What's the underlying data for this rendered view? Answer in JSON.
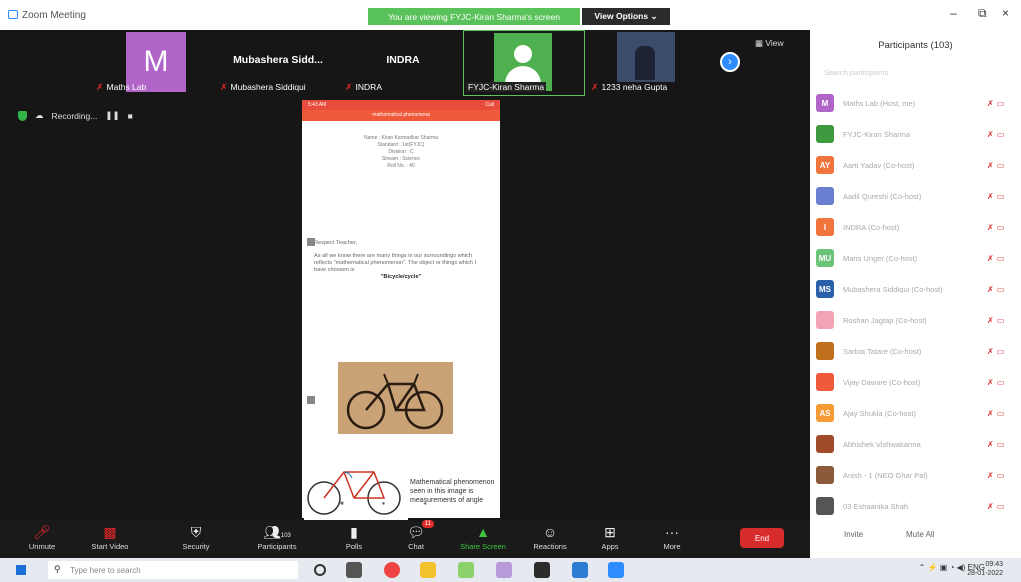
{
  "window": {
    "title": "Zoom Meeting",
    "banner": "You are viewing FYJC-Kiran Sharma's screen",
    "view_options": "View Options ⌄"
  },
  "thumbnails": [
    {
      "name": "Maths Lab",
      "avatar_letter": "M",
      "avatar_color": "#b165c9",
      "big_name": ""
    },
    {
      "name": "Mubashera Siddiqui",
      "avatar_letter": "",
      "avatar_color": "",
      "big_name": "Mubashera Sidd..."
    },
    {
      "name": "INDRA",
      "avatar_letter": "",
      "avatar_color": "",
      "big_name": "INDRA"
    },
    {
      "name": "FYJC-Kiran Sharma",
      "avatar_letter": "",
      "avatar_color": "#4fb04f",
      "big_name": ""
    },
    {
      "name": "1233 neha Gupta",
      "avatar_letter": "",
      "avatar_color": "",
      "big_name": ""
    }
  ],
  "view_label": "View",
  "recording_label": "Recording...",
  "phone": {
    "status_left": "5:43 AM",
    "status_right": "Call",
    "header": "mathematical phenomena",
    "info_lines": [
      "Name : Kiran Karmadkar Sharma",
      "Standard : 1st(FYJC)",
      "Division : C",
      "Stream : Science",
      "Roll No. : 40"
    ],
    "greeting": "Respect Teacher,",
    "body": "As all we know there are many things in our surroundings which reflects \"mathematical phenomenon\". The object or things which I have choosen is",
    "bold": "\"Bicycle/cycle\"",
    "caption": "Mathematical phenomenon seen in this image is measurements of angle"
  },
  "toolbar": {
    "unmute": "Unmute",
    "start_video": "Start Video",
    "security": "Security",
    "participants": "Participants",
    "participants_count": "103",
    "polls": "Polls",
    "chat": "Chat",
    "chat_badge": "11",
    "share_screen": "Share Screen",
    "reactions": "Reactions",
    "apps": "Apps",
    "more": "More",
    "end": "End"
  },
  "panel": {
    "title": "Participants (103)",
    "search_placeholder": "Search participants",
    "mute_all": "Mute All",
    "invite": "Invite",
    "participants": [
      {
        "initials": "M",
        "color": "#b165c9",
        "name": "Maths Lab (Host, me)"
      },
      {
        "initials": "",
        "color": "#3e9a3e",
        "name": "FYJC-Kiran Sharma"
      },
      {
        "initials": "AY",
        "color": "#f0743c",
        "name": "Aarti Yadav (Co-host)"
      },
      {
        "initials": "",
        "color": "#6a7fd0",
        "name": "Aadil Qureshi (Co-host)"
      },
      {
        "initials": "I",
        "color": "#f0743c",
        "name": "INDRA (Co-host)"
      },
      {
        "initials": "MU",
        "color": "#6cc47b",
        "name": "Maris Unger (Co-host)"
      },
      {
        "initials": "MS",
        "color": "#2b5fa8",
        "name": "Mubashera Siddiqui (Co-host)"
      },
      {
        "initials": "",
        "color": "#f3a5b5",
        "name": "Roshan Jagtap (Co-host)"
      },
      {
        "initials": "",
        "color": "#c0701c",
        "name": "Sarbat Tatare (Co-host)"
      },
      {
        "initials": "",
        "color": "#ef5a3a",
        "name": "Vijay Daware (Co-host)"
      },
      {
        "initials": "AS",
        "color": "#f59a35",
        "name": "Ajay Shukla (Co-host)"
      },
      {
        "initials": "",
        "color": "#a24b2a",
        "name": "Abhishek Vishwakarma"
      },
      {
        "initials": "",
        "color": "#8a5a3a",
        "name": "Anish - 1 (NEO Ghar Pal)"
      },
      {
        "initials": "",
        "color": "#555555",
        "name": "03 Eshaanika Shah"
      }
    ]
  },
  "taskbar": {
    "search_placeholder": "Type here to search",
    "lang": "ENG",
    "time": "09:43",
    "date": "28-01-2022"
  }
}
